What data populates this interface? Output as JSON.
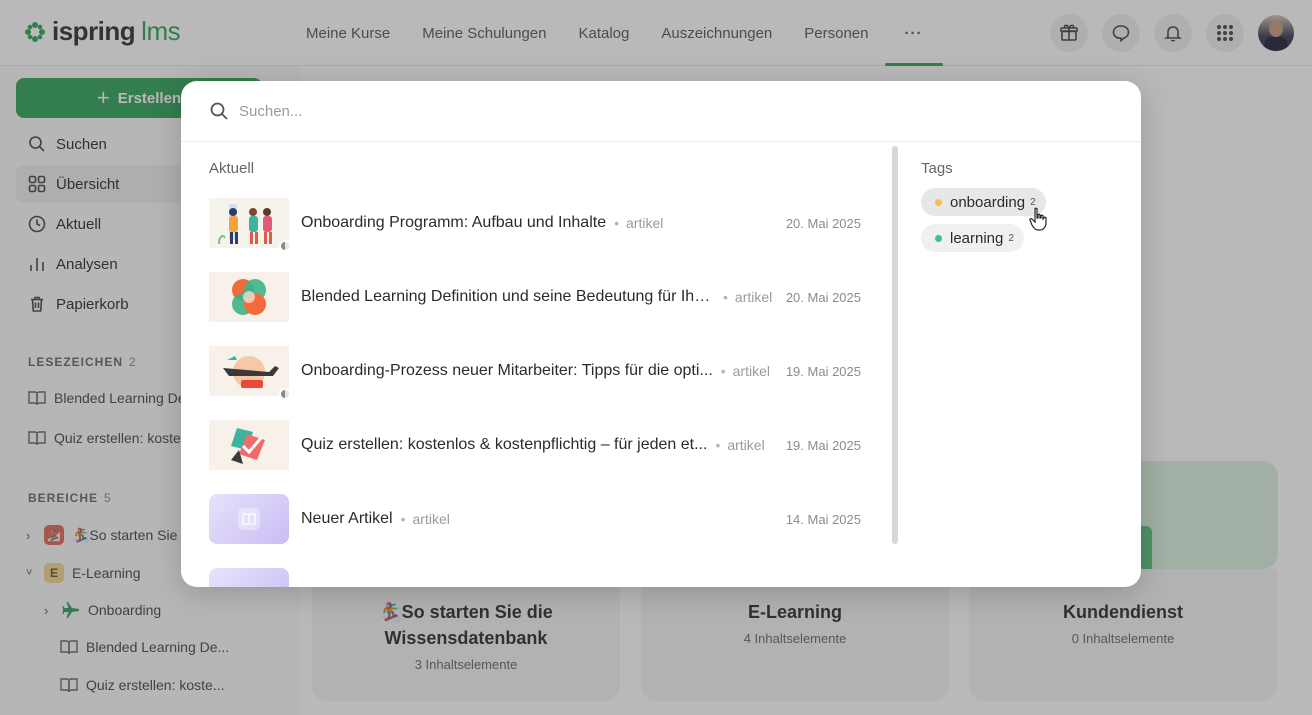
{
  "app": {
    "logo_word1": "ispring",
    "logo_word2": "lms",
    "brand_color": "#2fa25a"
  },
  "nav": {
    "items": [
      {
        "label": "Meine Kurse"
      },
      {
        "label": "Meine Schulungen"
      },
      {
        "label": "Katalog"
      },
      {
        "label": "Auszeichnungen"
      },
      {
        "label": "Personen"
      },
      {
        "label": "···"
      }
    ],
    "active_index": 5,
    "icons": [
      "gift-icon",
      "chat-icon",
      "bell-icon",
      "apps-grid-icon"
    ]
  },
  "sidebar": {
    "create_label": "Erstellen",
    "items": [
      {
        "label": "Suchen",
        "icon": "search-icon"
      },
      {
        "label": "Übersicht",
        "icon": "grid-icon"
      },
      {
        "label": "Aktuell",
        "icon": "clock-icon"
      },
      {
        "label": "Analysen",
        "icon": "bar-chart-icon"
      },
      {
        "label": "Papierkorb",
        "icon": "trash-icon"
      }
    ],
    "bookmarks_heading": "LESEZEICHEN",
    "bookmarks_count": "2",
    "bookmarks": [
      {
        "label": "Blended Learning De"
      },
      {
        "label": "Quiz erstellen: koste"
      }
    ],
    "areas_heading": "BEREICHE",
    "areas_count": "5",
    "areas": [
      {
        "label": "🏂So starten Sie"
      },
      {
        "label": "E-Learning",
        "letter": "E"
      },
      {
        "label": "Onboarding"
      },
      {
        "label": "Blended Learning De..."
      },
      {
        "label": "Quiz erstellen: koste..."
      }
    ]
  },
  "cards": [
    {
      "title_line1": "🏂So starten Sie die",
      "title_line2": "Wissensdatenbank",
      "sub": "3 Inhaltselemente"
    },
    {
      "title_line1": "E-Learning",
      "sub": "4 Inhaltselemente"
    },
    {
      "title_line1": "Kundendienst",
      "sub": "0 Inhaltselemente"
    }
  ],
  "search": {
    "placeholder": "Suchen...",
    "recent_heading": "Aktuell",
    "results": [
      {
        "title": "Onboarding Programm: Aufbau und Inhalte",
        "type": "artikel",
        "date": "20. Mai 2025"
      },
      {
        "title": "Blended Learning Definition und seine Bedeutung für Ihre...",
        "type": "artikel",
        "date": "20. Mai 2025"
      },
      {
        "title": "Onboarding-Prozess neuer Mitarbeiter: Tipps für die opti...",
        "type": "artikel",
        "date": "19. Mai 2025"
      },
      {
        "title": "Quiz erstellen: kostenlos & kostenpflichtig – für jeden et...",
        "type": "artikel",
        "date": "19. Mai 2025"
      },
      {
        "title": "Neuer Artikel",
        "type": "artikel",
        "date": "14. Mai 2025"
      }
    ],
    "tags_heading": "Tags",
    "tags": [
      {
        "label": "onboarding",
        "count": "2",
        "color": "#f2c14e"
      },
      {
        "label": "learning",
        "count": "2",
        "color": "#3cc29a"
      }
    ]
  }
}
